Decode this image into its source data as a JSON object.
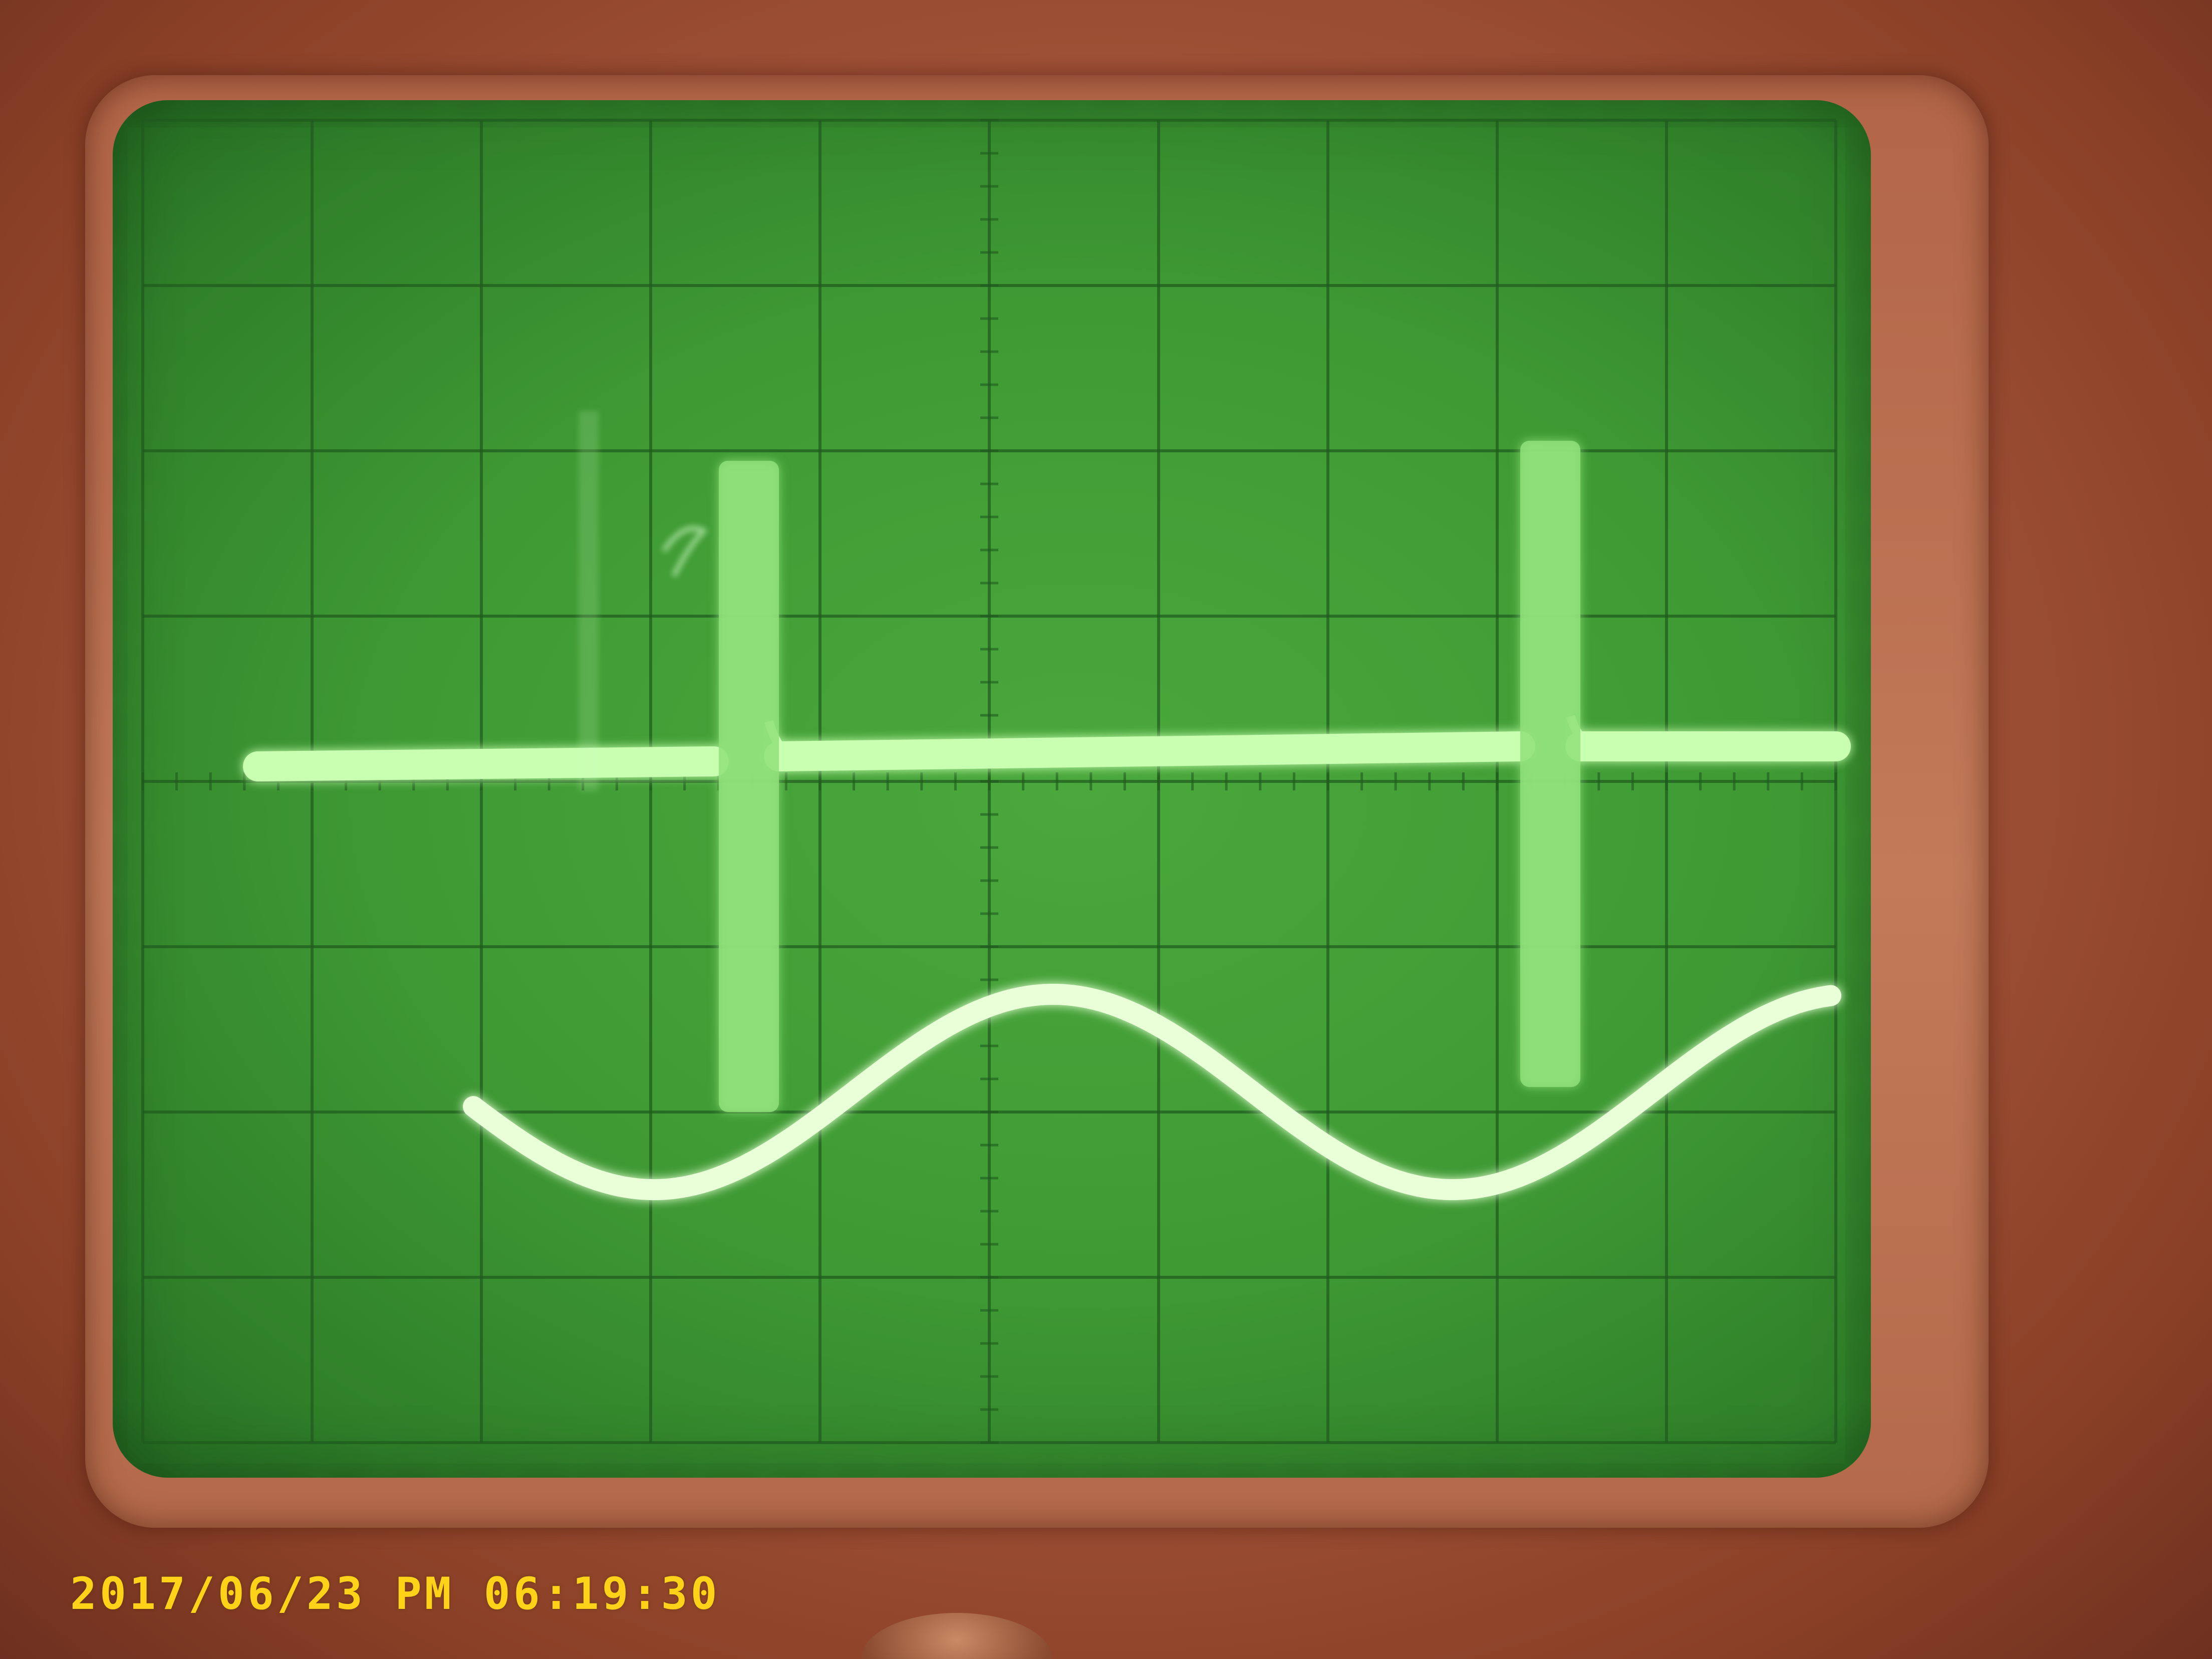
{
  "photo": {
    "timestamp": "2017/06/23 PM 06:19:30"
  },
  "colors": {
    "housing": "#a4553a",
    "screen": "#3f9a34",
    "grid": "#1f5a1e",
    "trace": "#c8ffb0",
    "timestamp": "#ffd21a"
  },
  "oscilloscope": {
    "graticule_divisions": [
      10,
      8
    ],
    "traces": [
      {
        "name": "",
        "shape": "dc level with periodic vertical spikes",
        "spike_count": 2
      },
      {
        "name": "",
        "shape": "sine wave",
        "cycles_visible": 1.7
      }
    ]
  }
}
